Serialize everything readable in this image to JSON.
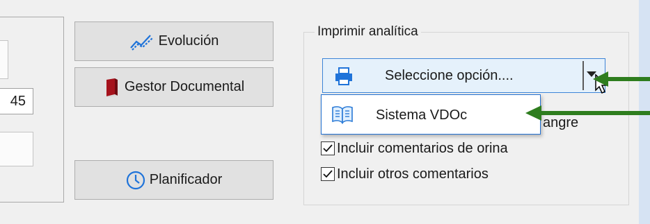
{
  "left_panel": {
    "number_value": "45"
  },
  "buttons": {
    "evolucion": "Evolución",
    "gestor": "Gestor Documental",
    "planificador": "Planificador"
  },
  "print_group": {
    "title": "Imprimir analítica",
    "combo": {
      "selected": "Seleccione opción....",
      "icon": "printer-icon"
    },
    "dropdown": {
      "items": [
        {
          "label": "Sistema VDOc",
          "icon": "book-icon"
        }
      ]
    },
    "checkboxes": [
      {
        "label": "...angre",
        "visible_text": "angre",
        "checked": true
      },
      {
        "label": "Incluir comentarios de orina",
        "checked": true
      },
      {
        "label": "Incluir otros comentarios",
        "checked": true
      }
    ]
  },
  "annotations": {
    "arrow_color": "#2e7d1e"
  },
  "colors": {
    "combo_border": "#3c84d7",
    "combo_bg": "#e5f1fb",
    "accent_icon": "#1f73d9",
    "book_red": "#a5121c"
  }
}
